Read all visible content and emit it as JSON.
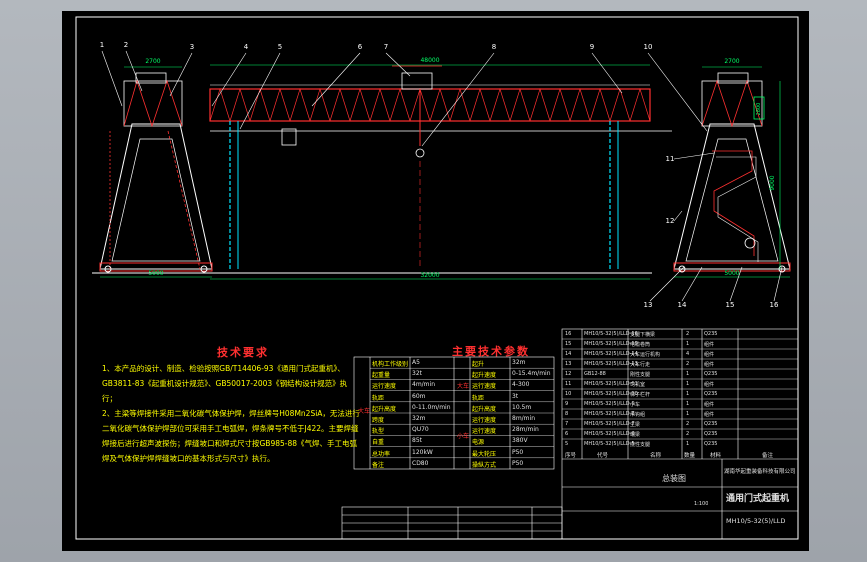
{
  "title_block": {
    "drawing_title": "通用门式起重机",
    "org_name": "湖南华起重装备科技有限公司",
    "doc_type": "总装图",
    "drawing_no": "MH10/5-32(5)/LLD",
    "scale_cell": "1:100"
  },
  "callouts": [
    "1",
    "2",
    "3",
    "4",
    "5",
    "6",
    "7",
    "8",
    "9",
    "10",
    "11",
    "12",
    "13",
    "14",
    "15",
    "16"
  ],
  "dimensions": {
    "top_left": "2700",
    "top_center": "48000",
    "top_right": "2700",
    "span": "32000",
    "base_left": "5000",
    "base_right": "5000",
    "height_right": "9000",
    "tag_right": "2800"
  },
  "technical_requirements": {
    "heading": "技术要求",
    "items": [
      "1、本产品的设计、制造、检验按照GB/T14406-93《通用门式起重机》、GB3811-83《起重机设计规范》、GB50017-2003《钢结构设计规范》执行；",
      "2、主梁等焊接件采用二氧化碳气体保护焊，焊丝牌号H08Mn2SiA，无法进行二氧化碳气体保护焊部位可采用手工电弧焊，焊条牌号不低于J422。主要焊缝焊接后进行超声波探伤；焊缝坡口和焊式尺寸按GB985-88《气焊、手工电弧焊及气体保护焊焊缝坡口的基本形式与尺寸》执行。"
    ]
  },
  "main_params": {
    "heading": "主要技术参数",
    "group_left": "大车",
    "group_mid_top": "大车",
    "group_mid_bottom": "小车",
    "rows": [
      [
        "机构工作级别",
        "A5",
        "起升",
        "32m"
      ],
      [
        "起重量",
        "32t",
        "起升速度",
        "0-15.4m/min"
      ],
      [
        "运行速度",
        "4m/min",
        "运行速度",
        "4-300"
      ],
      [
        "轨距",
        "60m",
        "轨距",
        "3t"
      ],
      [
        "起升高度",
        "0-11.0m/min",
        "起升高度",
        "10.5m"
      ],
      [
        "跨度",
        "32m",
        "运行速度",
        "8m/min"
      ],
      [
        "轨型",
        "QU70",
        "运行速度",
        "28m/min"
      ],
      [
        "自重",
        "85t",
        "电源",
        "380V"
      ],
      [
        "总功率",
        "120kW",
        "最大轮压",
        "P50"
      ],
      [
        "备注",
        "CD80",
        "操纵方式",
        "P50"
      ]
    ]
  },
  "parts_list": {
    "headers": [
      "序号",
      "代号",
      "名称",
      "数量",
      "材料",
      "备注"
    ],
    "rows": [
      [
        "16",
        "MH10/5-32(5)/LLD-16",
        "支腿下横梁",
        "2",
        "Q235"
      ],
      [
        "15",
        "MH10/5-32(5)/LLD-15",
        "电缆卷筒",
        "1",
        "组件"
      ],
      [
        "14",
        "MH10/5-32(5)/LLD-14",
        "大车运行机构",
        "4",
        "组件"
      ],
      [
        "13",
        "MH10/5-32(5)/LLD-13",
        "大车行走",
        "2",
        "组件"
      ],
      [
        "12",
        "GB12-88",
        "刚性支腿",
        "1",
        "Q235"
      ],
      [
        "11",
        "MH10/5-32(5)/LLD-11",
        "司机室",
        "1",
        "组件"
      ],
      [
        "10",
        "MH10/5-32(5)/LLD-10",
        "梯子栏杆",
        "1",
        "Q235"
      ],
      [
        "9",
        "MH10/5-32(5)/LLD-9",
        "小车",
        "1",
        "组件"
      ],
      [
        "8",
        "MH10/5-32(5)/LLD-8",
        "吊钩组",
        "1",
        "组件"
      ],
      [
        "7",
        "MH10/5-32(5)/LLD-7",
        "主梁",
        "2",
        "Q235"
      ],
      [
        "6",
        "MH10/5-32(5)/LLD-6",
        "端梁",
        "2",
        "Q235"
      ],
      [
        "5",
        "MH10/5-32(5)/LLD-5",
        "挠性支腿",
        "1",
        "Q235"
      ]
    ]
  },
  "colors": {
    "frame": "#ffffff",
    "truss": "#ff3030",
    "dim": "#00ff66",
    "cyan": "#00e5ff",
    "yellow": "#ffff00"
  }
}
